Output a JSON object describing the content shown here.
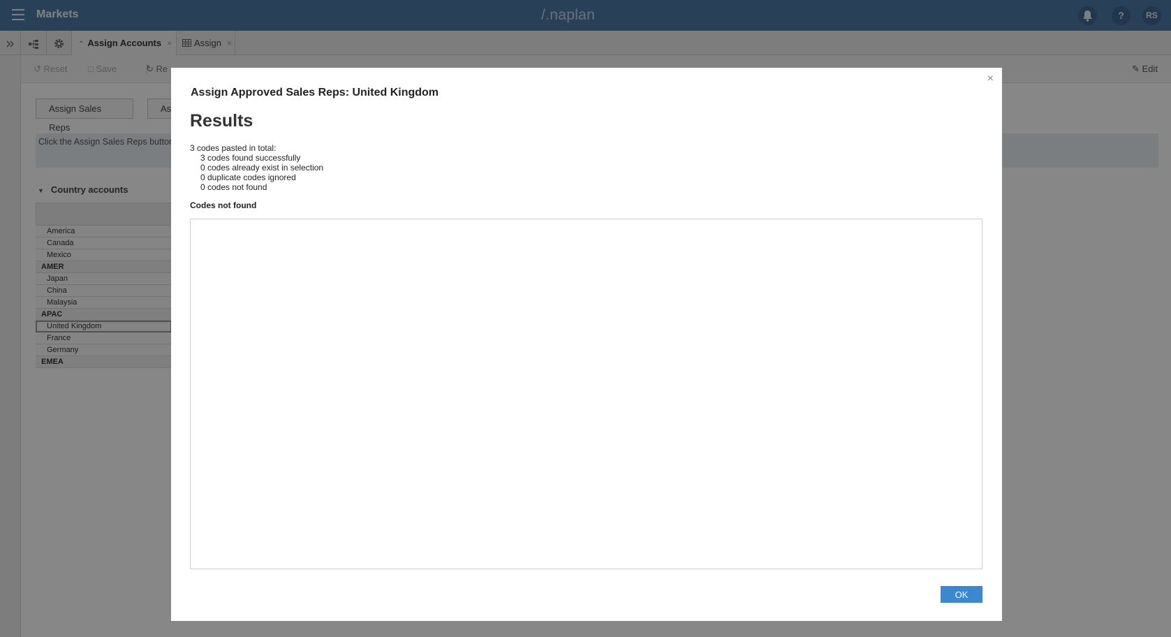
{
  "app": {
    "title": "Markets",
    "logo": "/.naplan",
    "user_initials": "RS",
    "help_label": "?"
  },
  "tabs": [
    {
      "label": "Assign Accounts",
      "close": "×"
    },
    {
      "label": "Assign",
      "close": "×"
    }
  ],
  "toolbar": {
    "reset_label": "Reset",
    "save_label": "Save",
    "refresh_label": "Re",
    "edit_label": "Edit"
  },
  "page": {
    "assign_sales_reps_label": "Assign Sales Reps",
    "second_button_label": "As",
    "info_text": "Click the Assign Sales Reps button",
    "section_title": "Country accounts",
    "rows": [
      "America",
      "Canada",
      "Mexico",
      "AMER",
      "Japan",
      "China",
      "Malaysia",
      "APAC",
      "United Kingdom",
      "France",
      "Germany",
      "EMEA"
    ]
  },
  "dialog": {
    "close": "×",
    "title": "Assign Approved Sales Reps: United Kingdom",
    "heading": "Results",
    "summary_total": "3 codes pasted in total:",
    "summary_lines": [
      "3 codes found successfully",
      "0 codes already exist in selection",
      "0 duplicate codes ignored",
      "0 codes not found"
    ],
    "not_found_label": "Codes not found",
    "not_found_value": "",
    "ok_label": "OK"
  },
  "icons": [
    "hamburger-icon",
    "bell-icon",
    "expand-icon",
    "hierarchy-icon",
    "gear-icon",
    "collapse-icon",
    "grid-icon",
    "reset-icon",
    "save-icon",
    "refresh-icon",
    "edit-icon",
    "close-icon",
    "chevron-down-icon"
  ],
  "colors": {
    "topbar": "#4f7ba6",
    "accent": "#3c88d0",
    "overlay": "rgba(0,0,0,0.47)"
  }
}
